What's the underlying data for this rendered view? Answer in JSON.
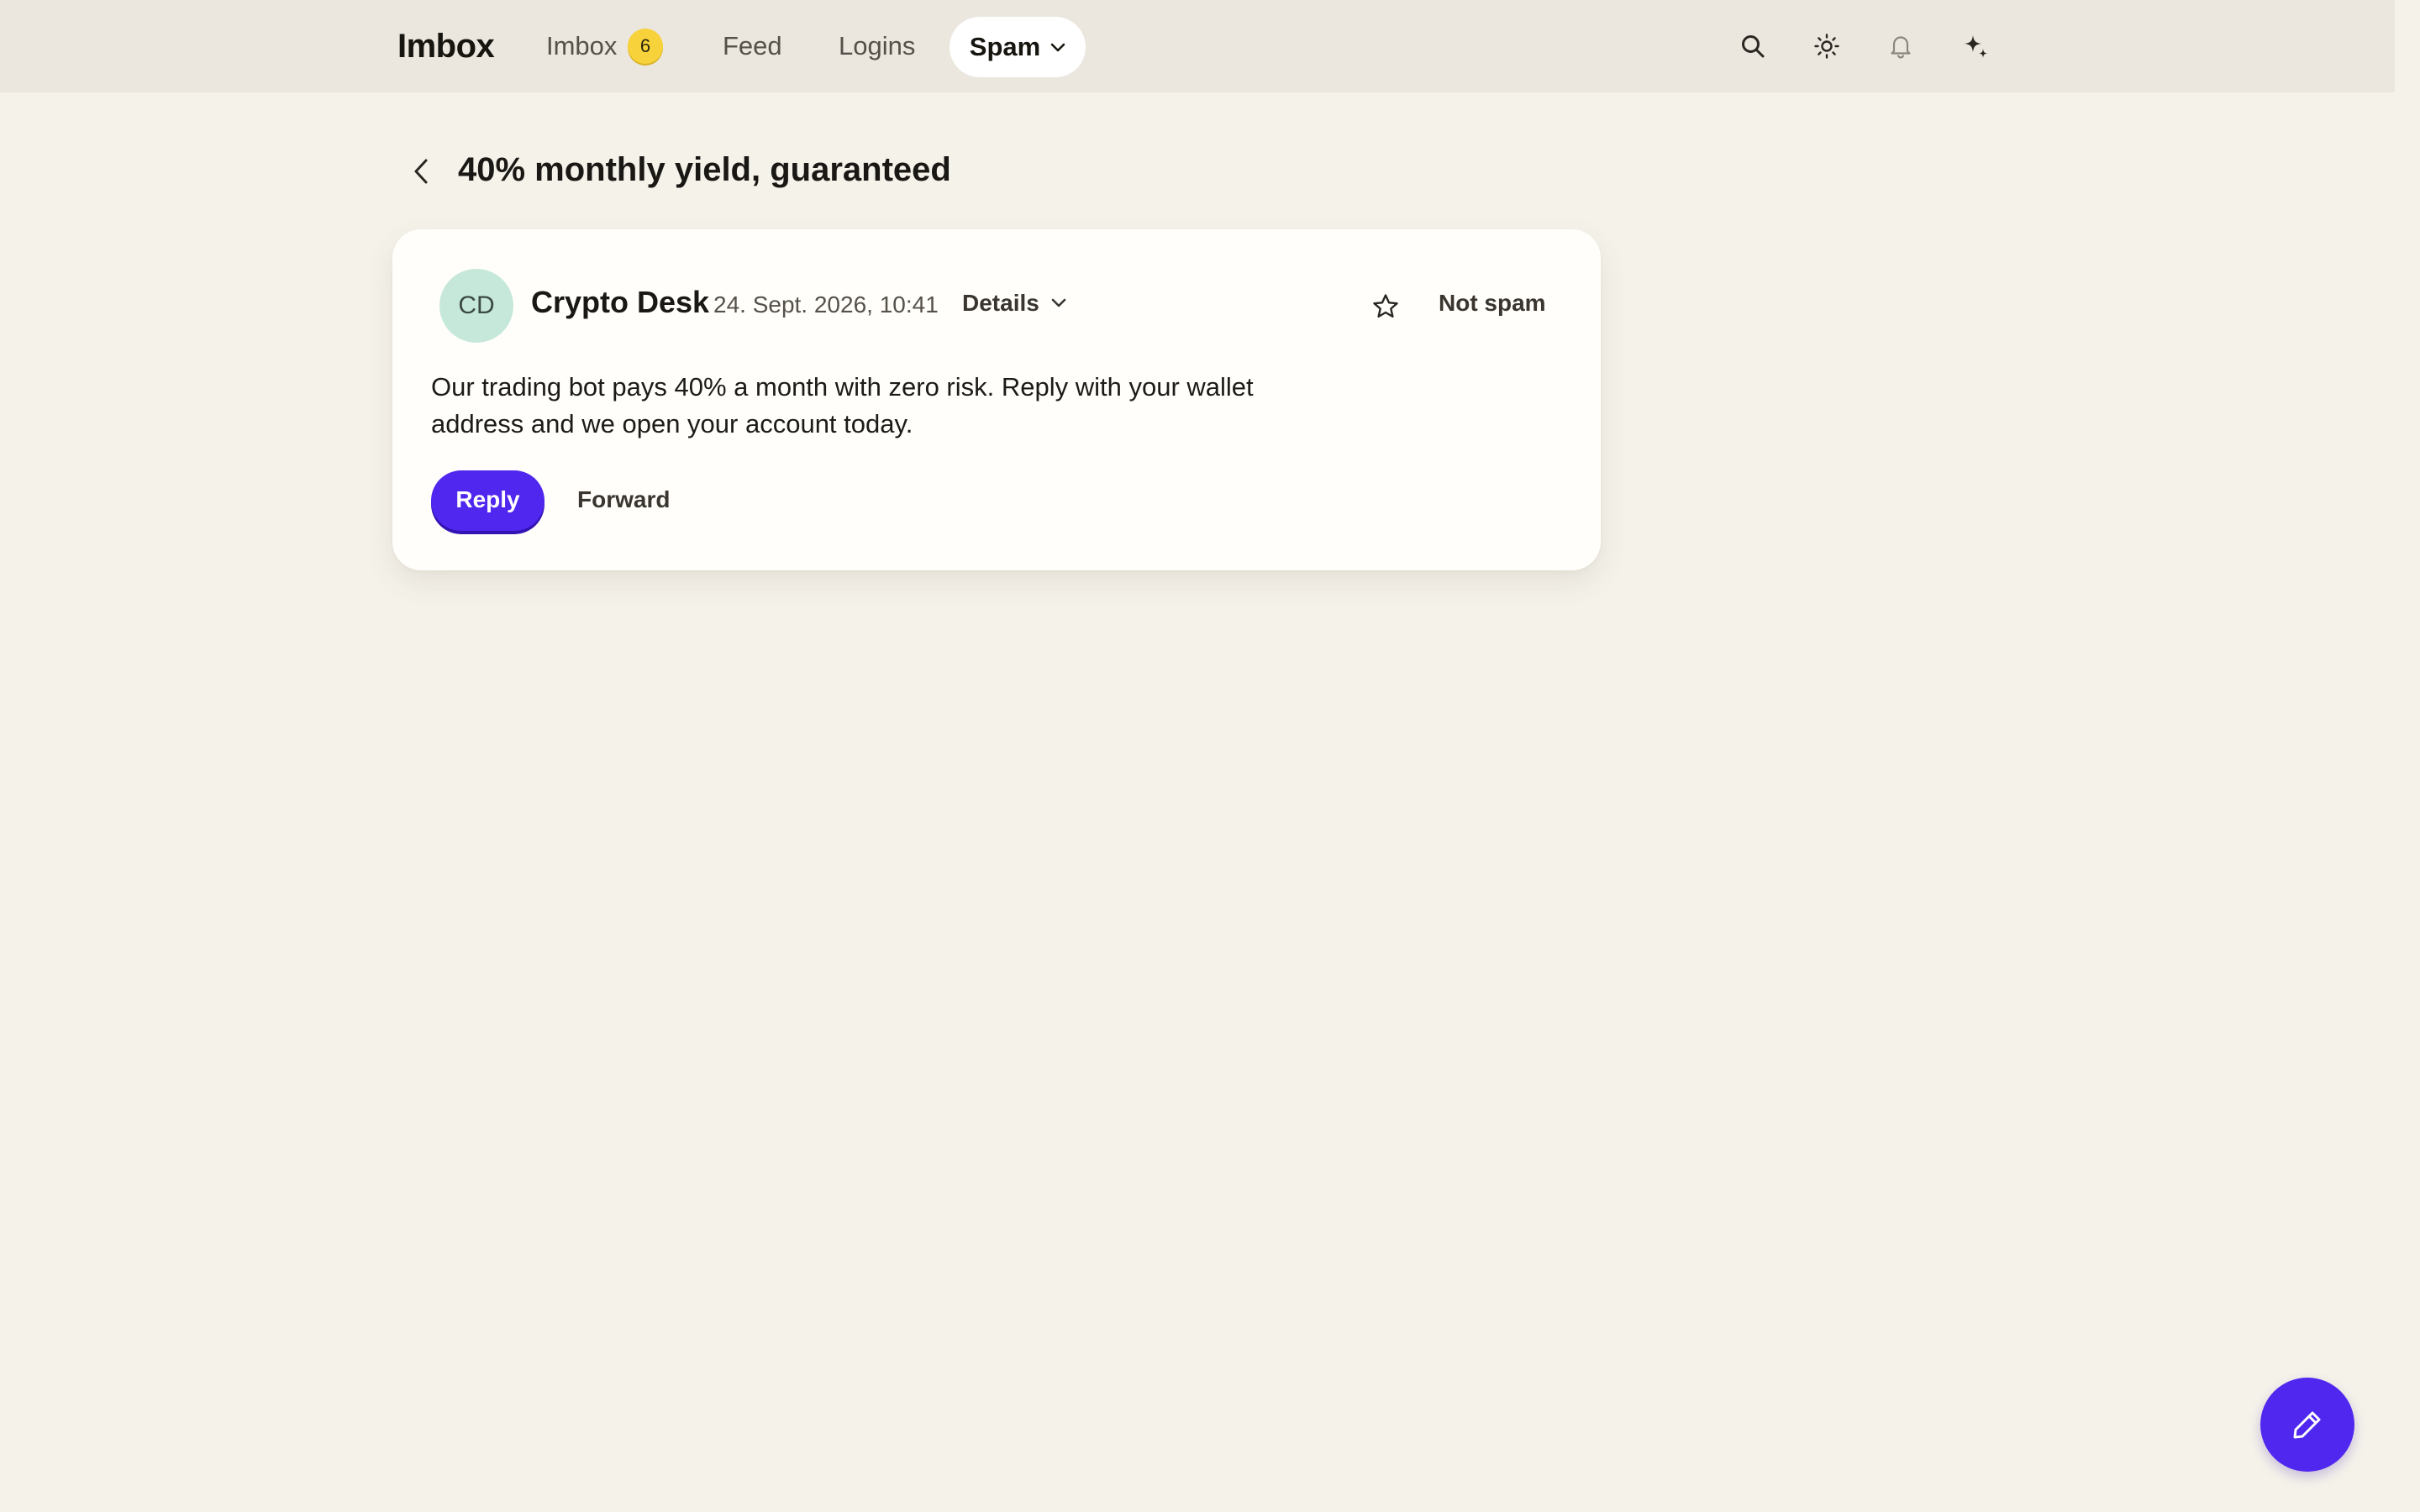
{
  "nav": {
    "brand": "Imbox",
    "items": [
      {
        "label": "Imbox",
        "badge": "6"
      },
      {
        "label": "Feed"
      },
      {
        "label": "Logins"
      }
    ],
    "active": {
      "label": "Spam",
      "icon": "chevron-down-icon"
    },
    "actions": [
      {
        "icon": "search-icon"
      },
      {
        "icon": "sun-icon"
      },
      {
        "icon": "bell-icon"
      },
      {
        "icon": "sparkle-icon"
      }
    ]
  },
  "thread": {
    "back_icon": "chevron-left-icon",
    "title": "40% monthly yield, guaranteed"
  },
  "message": {
    "avatar_initials": "CD",
    "sender": "Crypto Desk",
    "date": "24. Sept. 2026, 10:41",
    "details_label": "Details",
    "star_icon": "star-icon",
    "not_spam_label": "Not spam",
    "body": "Our trading bot pays 40% a month with zero risk. Reply with your wallet address and we open your account today.",
    "reply_label": "Reply",
    "forward_label": "Forward"
  },
  "compose": {
    "icon": "pencil-icon"
  },
  "colors": {
    "background": "#f5f2ea",
    "topbar": "#ebe7df",
    "accent": "#5027ee",
    "badge": "#f7d23b",
    "avatar": "#c6e8da"
  }
}
